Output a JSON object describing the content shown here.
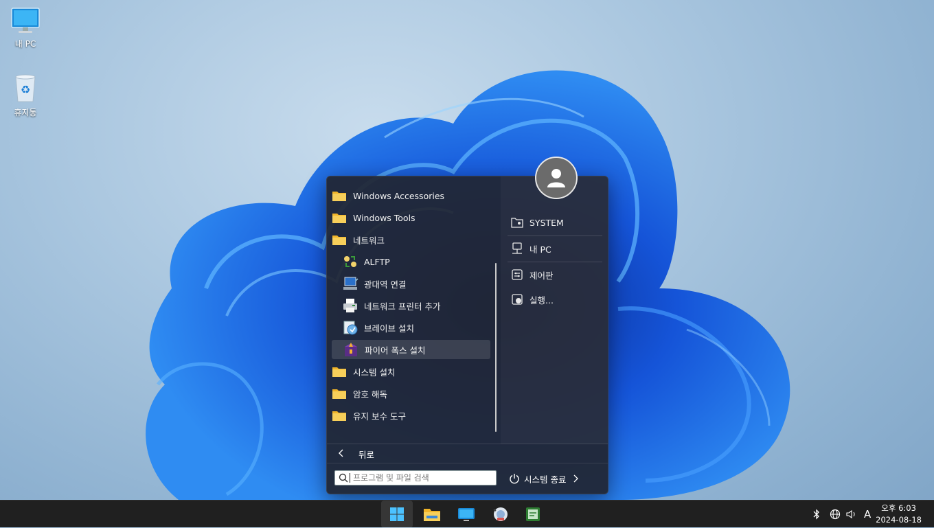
{
  "desktop": {
    "icons": [
      {
        "label": "내 PC",
        "icon": "monitor-icon"
      },
      {
        "label": "휴지통",
        "icon": "recycle-bin-icon"
      }
    ]
  },
  "start_menu": {
    "programs": [
      {
        "label": "Windows Accessories",
        "icon": "folder-icon",
        "indent": 0
      },
      {
        "label": "Windows Tools",
        "icon": "folder-icon",
        "indent": 0
      },
      {
        "label": "네트워크",
        "icon": "folder-icon",
        "indent": 0
      },
      {
        "label": "ALFTP",
        "icon": "ftp-transfer-icon",
        "indent": 1
      },
      {
        "label": "광대역 연결",
        "icon": "network-computer-icon",
        "indent": 1
      },
      {
        "label": "네트워크 프린터 추가",
        "icon": "printer-icon",
        "indent": 1
      },
      {
        "label": "브레이브 설치",
        "icon": "brave-installer-icon",
        "indent": 1
      },
      {
        "label": "파이어 폭스 설치",
        "icon": "firefox-installer-icon",
        "indent": 1,
        "highlighted": true
      },
      {
        "label": "시스템 설치",
        "icon": "folder-icon",
        "indent": 0
      },
      {
        "label": "암호 해독",
        "icon": "folder-icon",
        "indent": 0
      },
      {
        "label": "유지 보수 도구",
        "icon": "folder-icon",
        "indent": 0
      }
    ],
    "right": {
      "user_icon": "user-avatar-icon",
      "items": [
        {
          "label": "SYSTEM",
          "icon": "user-folder-icon"
        },
        {
          "label": "내 PC",
          "icon": "computer-icon"
        },
        {
          "label": "제어판",
          "icon": "control-panel-icon"
        },
        {
          "label": "실행...",
          "icon": "run-icon"
        }
      ]
    },
    "back_label": "뒤로",
    "search_placeholder": "프로그램 및 파일 검색",
    "power_label": "시스템 종료"
  },
  "taskbar": {
    "apps": [
      {
        "name": "start",
        "icon": "windows-logo-icon",
        "active": true
      },
      {
        "name": "file-explorer",
        "icon": "folder-icon"
      },
      {
        "name": "desktop",
        "icon": "monitor-icon"
      },
      {
        "name": "app-4",
        "icon": "app-icon"
      },
      {
        "name": "app-5",
        "icon": "app-icon"
      }
    ],
    "tray": {
      "ime": "A",
      "time": "오후 6:03",
      "date": "2024-08-18"
    }
  },
  "colors": {
    "accent": "#0078d4",
    "start_bg": "#212632",
    "taskbar_bg": "#202020",
    "folder": "#f5c542"
  }
}
